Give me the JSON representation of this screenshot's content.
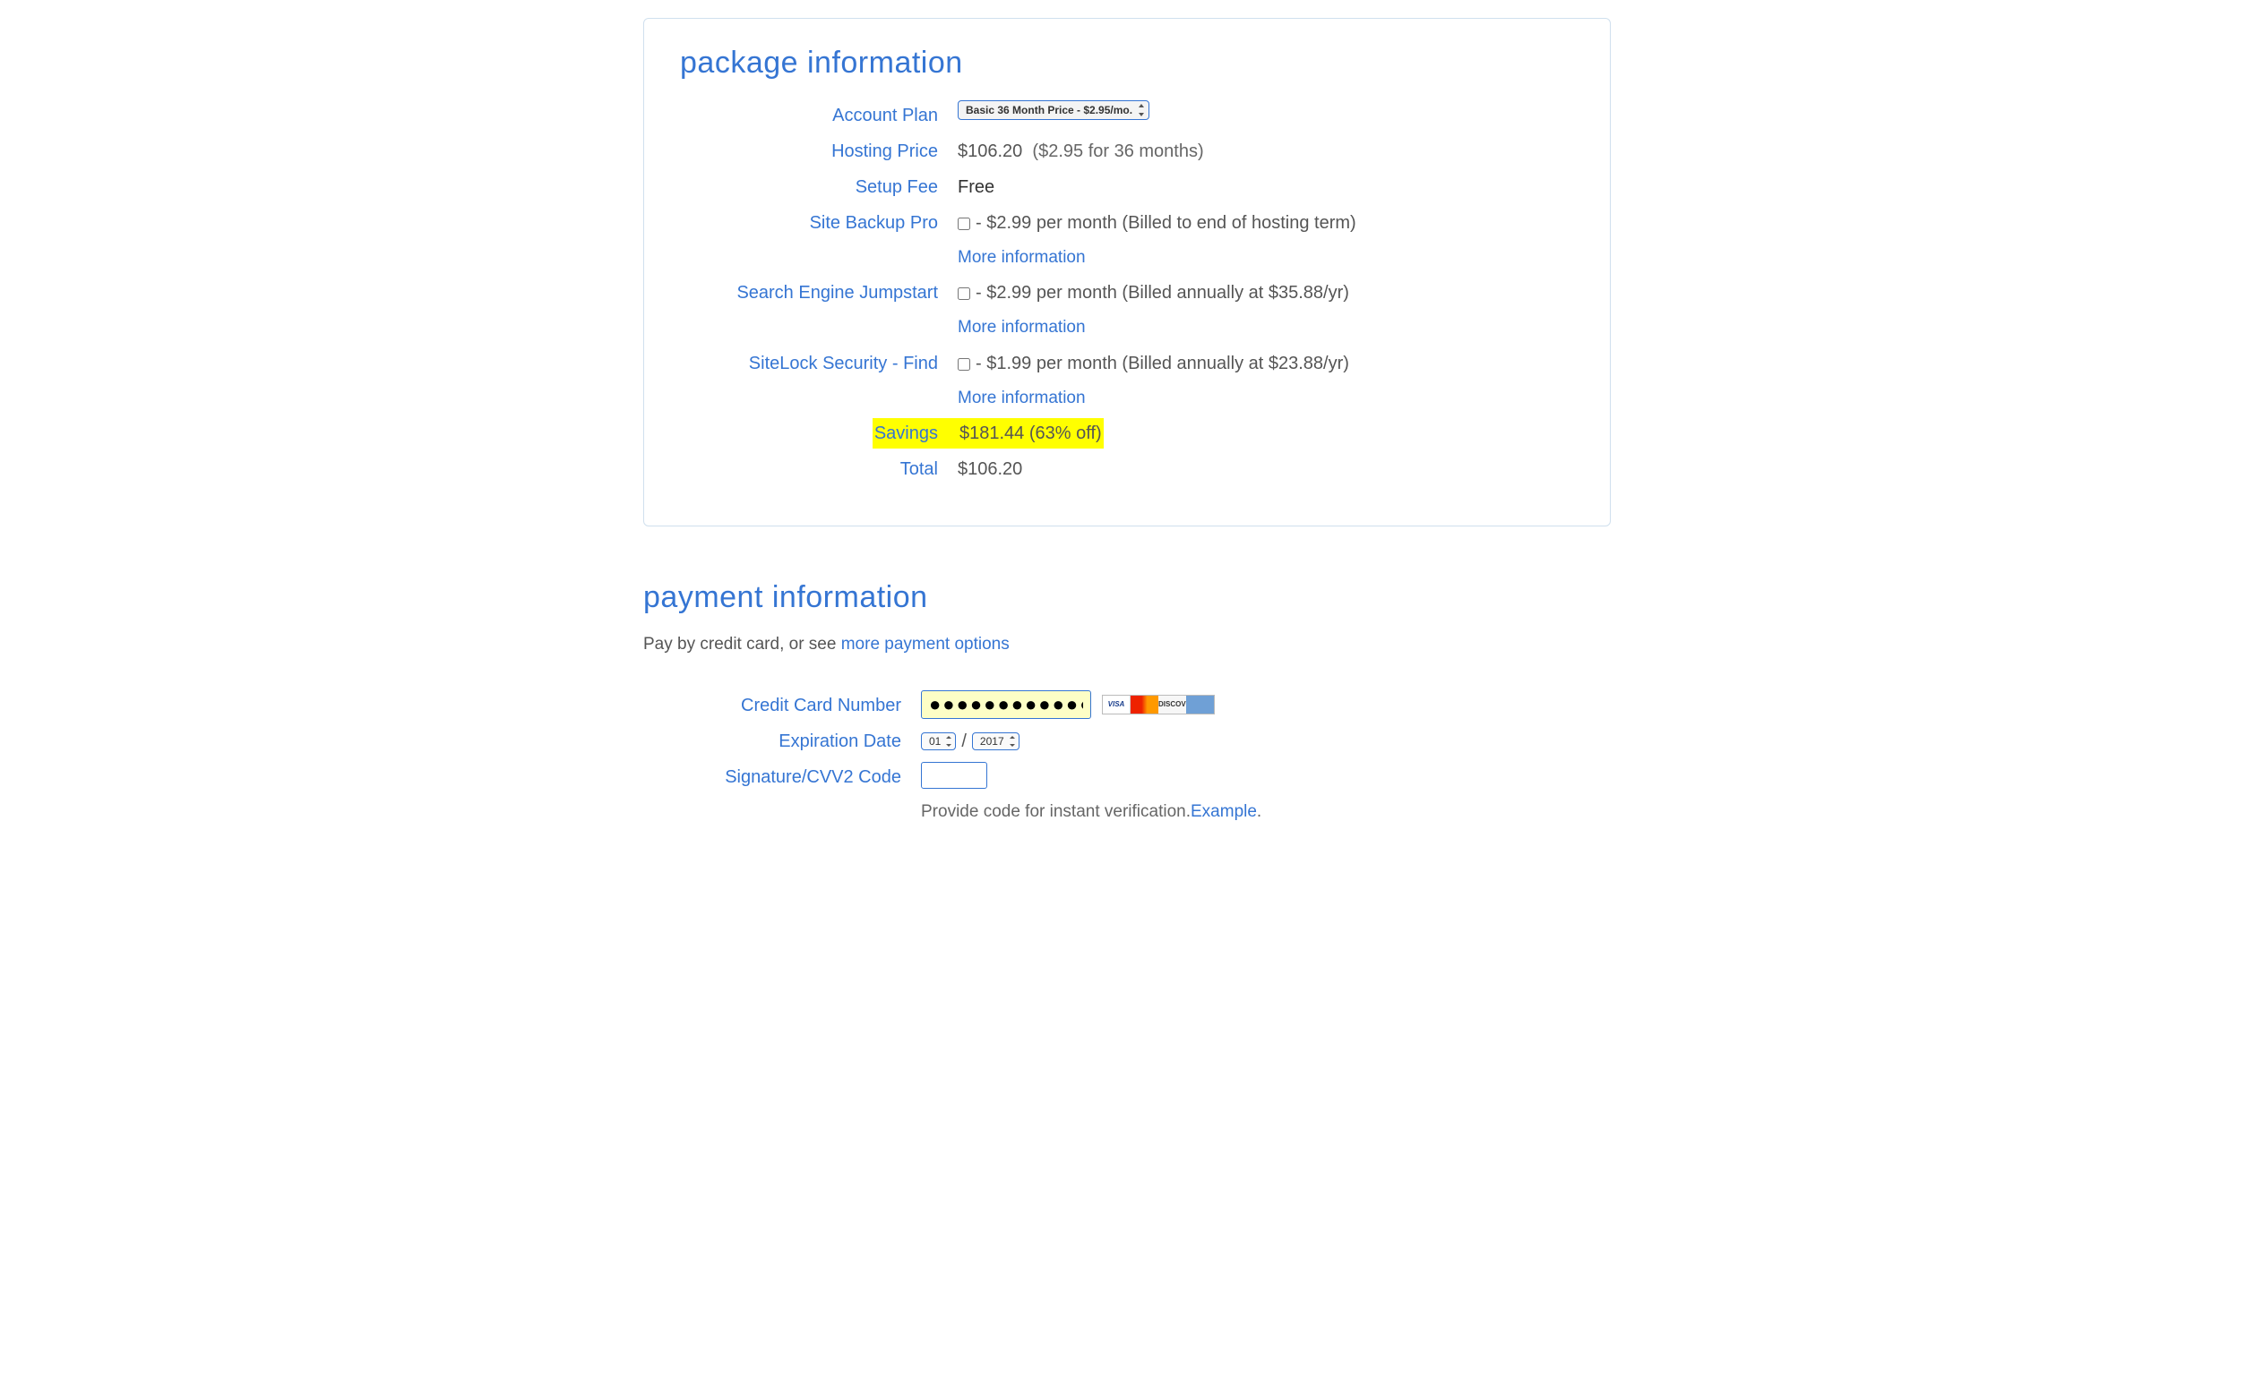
{
  "package": {
    "heading": "package information",
    "account_plan_label": "Account Plan",
    "account_plan_selected": "Basic 36 Month Price - $2.95/mo.",
    "hosting_price_label": "Hosting Price",
    "hosting_price_value": "$106.20",
    "hosting_price_sub": "($2.95 for 36 months)",
    "setup_fee_label": "Setup Fee",
    "setup_fee_value": "Free",
    "more_info": "More information",
    "addons": {
      "backup": {
        "label": "Site Backup Pro",
        "desc": "- $2.99 per month (Billed to end of hosting term)"
      },
      "jumpstart": {
        "label": "Search Engine Jumpstart",
        "desc": "- $2.99 per month (Billed annually at $35.88/yr)"
      },
      "sitelock": {
        "label": "SiteLock Security - Find",
        "desc": "- $1.99 per month (Billed annually at $23.88/yr)"
      }
    },
    "savings_label": "Savings",
    "savings_value": "$181.44 (63% off)",
    "total_label": "Total",
    "total_value": "$106.20"
  },
  "payment": {
    "heading": "payment information",
    "lead_text": "Pay by credit card, or see ",
    "lead_link": "more payment options",
    "cc_label": "Credit Card Number",
    "cc_value": "●●●●●●●●●●●●●",
    "exp_label": "Expiration Date",
    "exp_month": "01",
    "exp_sep": "/",
    "exp_year": "2017",
    "cvv_label": "Signature/CVV2 Code",
    "cvv_hint_text": "Provide code for instant verification. ",
    "cvv_hint_link": "Example",
    "cvv_hint_period": "."
  }
}
